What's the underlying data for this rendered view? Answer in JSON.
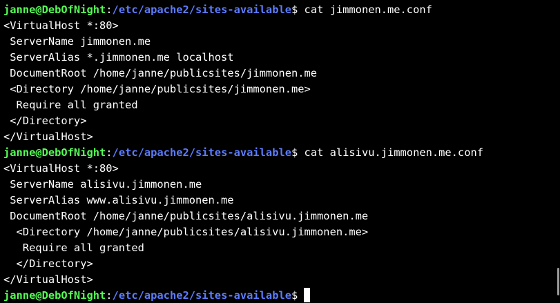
{
  "prompt": {
    "user_host": "janne@DebOfNight",
    "sep": ":",
    "path": "/etc/apache2/sites-available",
    "symbol": "$"
  },
  "lines": [
    {
      "type": "prompt",
      "command": " cat jimmonen.me.conf"
    },
    {
      "type": "out",
      "text": "<VirtualHost *:80>"
    },
    {
      "type": "out",
      "text": " ServerName jimmonen.me"
    },
    {
      "type": "out",
      "text": " ServerAlias *.jimmonen.me localhost"
    },
    {
      "type": "out",
      "text": " DocumentRoot /home/janne/publicsites/jimmonen.me"
    },
    {
      "type": "out",
      "text": " <Directory /home/janne/publicsites/jimmonen.me>"
    },
    {
      "type": "out",
      "text": "  Require all granted"
    },
    {
      "type": "out",
      "text": " </Directory>"
    },
    {
      "type": "out",
      "text": "</VirtualHost>"
    },
    {
      "type": "prompt",
      "command": " cat alisivu.jimmonen.me.conf"
    },
    {
      "type": "out",
      "text": "<VirtualHost *:80>"
    },
    {
      "type": "out",
      "text": " ServerName alisivu.jimmonen.me"
    },
    {
      "type": "out",
      "text": " ServerAlias www.alisivu.jimmonen.me"
    },
    {
      "type": "out",
      "text": " DocumentRoot /home/janne/publicsites/alisivu.jimmonen.me"
    },
    {
      "type": "out",
      "text": "  <Directory /home/janne/publicsites/alisivu.jimmonen.me>"
    },
    {
      "type": "out",
      "text": "   Require all granted"
    },
    {
      "type": "out",
      "text": "  </Directory>"
    },
    {
      "type": "out",
      "text": "</VirtualHost>"
    },
    {
      "type": "prompt",
      "command": ""
    }
  ],
  "colors": {
    "background": "#000000",
    "text": "#ffffff",
    "user_host": "#55ff55",
    "path": "#5c7cff"
  }
}
